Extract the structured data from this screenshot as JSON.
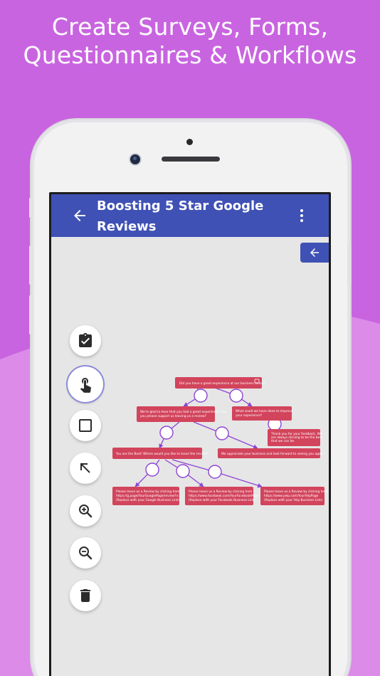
{
  "headline": {
    "line1": "Create Surveys, Forms,",
    "line2": "Questionnaires & Workflows"
  },
  "colors": {
    "background": "#c964e0",
    "wave": "#dc8be8",
    "appbar": "#3f51b5",
    "node": "#d2445c",
    "connector": "#8e44d6",
    "canvas": "#e6e6e6"
  },
  "appbar": {
    "back_icon": "arrow-left-icon",
    "title": "Boosting 5 Star Google Reviews",
    "menu_icon": "more-vert-icon"
  },
  "panel_toggle_icon": "arrow-left-icon",
  "toolbar": [
    {
      "name": "clipboard-check-icon",
      "active": false
    },
    {
      "name": "touch-icon",
      "active": true
    },
    {
      "name": "square-icon",
      "active": false
    },
    {
      "name": "arrow-up-left-icon",
      "active": false
    },
    {
      "name": "zoom-in-icon",
      "active": false
    },
    {
      "name": "zoom-out-icon",
      "active": false
    },
    {
      "name": "trash-icon",
      "active": false
    }
  ],
  "flow": {
    "nodes": [
      {
        "id": "q1",
        "lines": [
          "Did you have a great experience at our business today?"
        ]
      },
      {
        "id": "yes1",
        "lines": [
          "We're glad to hear that you had a great experience. Can",
          "you please support us leaving us a review?"
        ]
      },
      {
        "id": "no1",
        "lines": [
          "What could we have done to improve",
          "your experience?"
        ]
      },
      {
        "id": "thanks",
        "lines": [
          "Thank you for your feedback. We",
          "are always striving to be the best",
          "that we can be."
        ]
      },
      {
        "id": "where",
        "lines": [
          "You are the Best! Where would you like to leave the review?"
        ]
      },
      {
        "id": "appreciate",
        "lines": [
          "We appreciate your business and look forward to seeing you again!"
        ]
      },
      {
        "id": "google",
        "lines": [
          "Please leave us a Review by clicking here",
          "https://g.page/YourGooglePage/review?rc",
          "(Replace with your Google Business Link)"
        ]
      },
      {
        "id": "facebook",
        "lines": [
          "Please leave us a Review by clicking here",
          "https://www.facebook.com/YourFacebookPage",
          "(Replace with your Facebook Business Link)"
        ]
      },
      {
        "id": "yelp",
        "lines": [
          "Please leave us a Review by clicking here",
          "https://www.yelp.com/YourYelpPage",
          "(Replace with your Yelp Business Link)"
        ]
      }
    ]
  }
}
